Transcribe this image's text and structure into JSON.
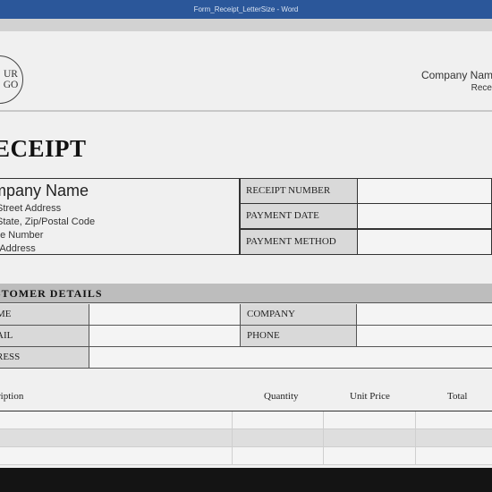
{
  "window": {
    "title": "Form_Receipt_LetterSize  -  Word"
  },
  "header": {
    "logo_text": "UR\nGO",
    "company_name": "Company Nam",
    "receipt_label": "Rece"
  },
  "document": {
    "title": "ECEIPT",
    "company": {
      "name": "mpany Name",
      "address_lines": [
        "Street Address",
        "State, Zip/Postal Code",
        "ne Number",
        "il Address"
      ]
    },
    "receipt_fields": [
      {
        "label": "RECEIPT NUMBER",
        "value": ""
      },
      {
        "label": "PAYMENT DATE",
        "value": ""
      },
      {
        "label": "PAYMENT METHOD",
        "value": ""
      }
    ],
    "customer_details": {
      "heading": "STOMER DETAILS",
      "name_label": "ME",
      "company_label": "COMPANY",
      "email_label": "AIL",
      "phone_label": "PHONE",
      "address_label": "RESS"
    },
    "items_table": {
      "columns": [
        "ription",
        "Quantity",
        "Unit Price",
        "Total"
      ]
    }
  }
}
